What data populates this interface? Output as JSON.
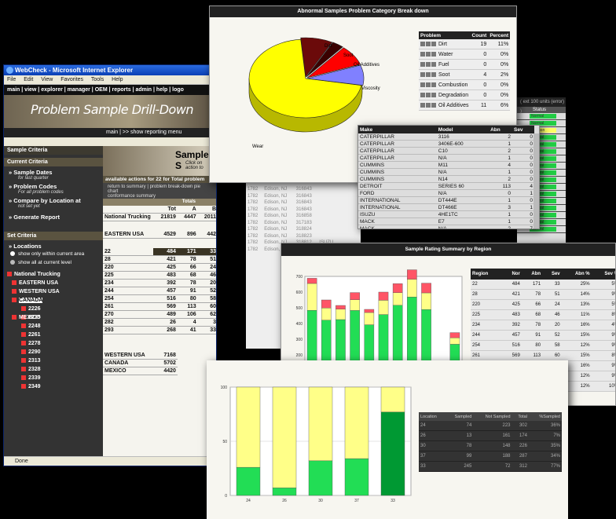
{
  "ie": {
    "title": "WebCheck - Microsoft Internet Explorer",
    "menu": [
      "File",
      "Edit",
      "View",
      "Favorites",
      "Tools",
      "Help"
    ],
    "nav": "main | view | explorer | manager | OEM | reports | admin | help | logo",
    "banner_title": "Problem Sample Drill-Down",
    "crumbs": "main | >> show reporting menu",
    "sidebar": {
      "sample_criteria": "Sample Criteria",
      "current_criteria": "Current Criteria",
      "sample_dates": "Sample Dates",
      "sample_dates_sub": "for last quarter",
      "problem_codes": "Problem Codes",
      "problem_codes_sub": "For all problem codes",
      "compare_by": "Compare by Location at",
      "compare_sub": "not set yet",
      "generate": "Generate Report",
      "set_criteria": "Set Criteria",
      "locations": "Locations",
      "radio_current": "show only within current area",
      "radio_all": "show all at current level"
    },
    "tree": {
      "root": "National Trucking",
      "nodes": [
        "EASTERN USA",
        "WESTERN USA",
        "CANADA"
      ],
      "leaves": [
        "2226",
        "2235",
        "2248",
        "2261",
        "2278",
        "2290",
        "2313",
        "2328",
        "2339",
        "2349"
      ],
      "last": "MEXICO"
    },
    "main": {
      "banner_title": "Sample S",
      "banner_desc1": "Click on",
      "banner_desc2": "action to",
      "actions": "available actions for 22 for Total problem",
      "links1": "return to summary | problem break-down pie chart",
      "links2": "conformance summary",
      "totals_label": "Totals",
      "col_headers": [
        "Tot",
        "A",
        "B"
      ],
      "rows": [
        {
          "name": "National Trucking",
          "v": [
            "21819",
            "4447",
            "2011"
          ]
        },
        {
          "name": "EASTERN USA",
          "v": [
            "4529",
            "896",
            "442"
          ]
        }
      ],
      "sub_rows": [
        {
          "name": "22",
          "v": [
            "484",
            "171",
            "33"
          ]
        },
        {
          "name": "28",
          "v": [
            "421",
            "78",
            "51"
          ]
        },
        {
          "name": "220",
          "v": [
            "425",
            "66",
            "24"
          ]
        },
        {
          "name": "225",
          "v": [
            "483",
            "68",
            "46"
          ]
        },
        {
          "name": "234",
          "v": [
            "392",
            "78",
            "20"
          ]
        },
        {
          "name": "244",
          "v": [
            "457",
            "91",
            "52"
          ]
        },
        {
          "name": "254",
          "v": [
            "516",
            "80",
            "58"
          ]
        },
        {
          "name": "261",
          "v": [
            "569",
            "113",
            "60"
          ]
        },
        {
          "name": "270",
          "v": [
            "489",
            "106",
            "62"
          ]
        },
        {
          "name": "282",
          "v": [
            "26",
            "4",
            "3"
          ]
        },
        {
          "name": "293",
          "v": [
            "268",
            "41",
            "33"
          ]
        }
      ],
      "bottom_rows": [
        {
          "name": "WESTERN USA",
          "v": "7168"
        },
        {
          "name": "CANADA",
          "v": "5702"
        },
        {
          "name": "MEXICO",
          "v": "4420"
        }
      ]
    },
    "status": "Done"
  },
  "detail": {
    "rows": [
      [
        "1782",
        "Edison, NJ",
        "316843",
        ""
      ],
      [
        "1782",
        "Edison, NJ",
        "316843",
        ""
      ],
      [
        "1782",
        "Edison, NJ",
        "316843",
        ""
      ],
      [
        "1782",
        "Edison, NJ",
        "316843",
        ""
      ],
      [
        "1782",
        "Edison, NJ",
        "316858",
        ""
      ],
      [
        "1782",
        "Edison, NJ",
        "317183",
        ""
      ],
      [
        "1782",
        "Edison, NJ",
        "318824",
        ""
      ],
      [
        "1782",
        "Edison, NJ",
        "318823",
        ""
      ],
      [
        "1782",
        "Edison, NJ",
        "318812",
        "ISUZU"
      ],
      [
        "1782",
        "Edison, NJ",
        "322287",
        "CATERPILLAR"
      ]
    ]
  },
  "cutwin": {
    "header": "( ext 100 units (error) )",
    "label": "Status",
    "statuses": [
      "Normal",
      "Normal",
      "Caution",
      "Normal",
      "Normal",
      "Normal",
      "Normal",
      "Normal",
      "Normal",
      "Normal",
      "Normal",
      "Normal",
      "Normal",
      "Normal",
      "Normal",
      "Normal",
      "Normal"
    ]
  },
  "pie": {
    "title": "Abnormal Samples Problem Category Break down",
    "headers": [
      "Problem",
      "Count",
      "Percent"
    ],
    "rows": [
      {
        "name": "Dirt",
        "count": "19",
        "pct": "11%"
      },
      {
        "name": "Water",
        "count": "0",
        "pct": "0%"
      },
      {
        "name": "Fuel",
        "count": "0",
        "pct": "0%"
      },
      {
        "name": "Soot",
        "count": "4",
        "pct": "2%"
      },
      {
        "name": "Combustion",
        "count": "0",
        "pct": "0%"
      },
      {
        "name": "Degradation",
        "count": "0",
        "pct": "0%"
      },
      {
        "name": "Oil Additives",
        "count": "11",
        "pct": "6%"
      }
    ],
    "labels": {
      "dirt": "Dirt",
      "soot": "Soot",
      "oil": "Oil Additives",
      "visc": "Viscosity",
      "wear": "Wear"
    },
    "colors": {
      "dirt": "#6b0a0a",
      "soot": "#3a0000",
      "oil": "#ff0000",
      "visc": "#8080ff",
      "wear": "#ffff00",
      "wear_side": "#b8b800"
    }
  },
  "models": {
    "headers": [
      "Make",
      "Model",
      "Abn",
      "Sev"
    ],
    "rows": [
      [
        "CATERPILLAR",
        "3116",
        "2",
        "0"
      ],
      [
        "CATERPILLAR",
        "3406E-600",
        "1",
        "0"
      ],
      [
        "CATERPILLAR",
        "C10",
        "2",
        "0"
      ],
      [
        "CATERPILLAR",
        "N/A",
        "1",
        "0"
      ],
      [
        "CUMMINS",
        "M11",
        "4",
        "0"
      ],
      [
        "CUMMINS",
        "N/A",
        "1",
        "0"
      ],
      [
        "CUMMINS",
        "N14",
        "2",
        "0"
      ],
      [
        "DETROIT",
        "SERIES 60",
        "113",
        "4"
      ],
      [
        "FORD",
        "N/A",
        "0",
        "1"
      ],
      [
        "INTERNATIONAL",
        "DT444E",
        "1",
        "0"
      ],
      [
        "INTERNATIONAL",
        "DT466E",
        "3",
        "1"
      ],
      [
        "ISUZU",
        "4HE1TC",
        "1",
        "0"
      ],
      [
        "MACK",
        "E7",
        "1",
        "0"
      ],
      [
        "MACK",
        "N/A",
        "2",
        "7"
      ]
    ]
  },
  "region": {
    "title": "Sample Rating Summary by Region",
    "headers": [
      "Region",
      "Nor",
      "Abn",
      "Sev",
      "Abn %",
      "Sev %"
    ],
    "rows": [
      [
        "22",
        "484",
        "171",
        "33",
        "25%",
        "5%"
      ],
      [
        "28",
        "421",
        "78",
        "51",
        "14%",
        "9%"
      ],
      [
        "220",
        "425",
        "66",
        "24",
        "13%",
        "5%"
      ],
      [
        "225",
        "483",
        "68",
        "46",
        "11%",
        "8%"
      ],
      [
        "234",
        "392",
        "78",
        "20",
        "16%",
        "4%"
      ],
      [
        "244",
        "457",
        "91",
        "52",
        "15%",
        "9%"
      ],
      [
        "254",
        "516",
        "80",
        "58",
        "12%",
        "9%"
      ],
      [
        "261",
        "569",
        "113",
        "60",
        "15%",
        "8%"
      ],
      [
        "270",
        "489",
        "106",
        "62",
        "16%",
        "9%"
      ],
      [
        "282",
        "26",
        "4",
        "3",
        "12%",
        "9%"
      ],
      [
        "293",
        "268",
        "41",
        "33",
        "12%",
        "10%"
      ]
    ],
    "chart_data": {
      "type": "bar",
      "categories": [
        "22",
        "28",
        "220",
        "225",
        "234",
        "244",
        "254",
        "261",
        "270",
        "282",
        "293"
      ],
      "series": [
        {
          "name": "Nor",
          "values": [
            484,
            421,
            425,
            483,
            392,
            457,
            516,
            569,
            489,
            26,
            268
          ]
        },
        {
          "name": "Abn",
          "values": [
            171,
            78,
            66,
            68,
            78,
            91,
            80,
            113,
            106,
            4,
            41
          ]
        },
        {
          "name": "Sev",
          "values": [
            33,
            51,
            24,
            46,
            20,
            52,
            58,
            60,
            62,
            3,
            33
          ]
        }
      ],
      "yticks": [
        "700",
        "600",
        "500",
        "400",
        "300",
        "200",
        "100",
        "0"
      ],
      "ylim": [
        0,
        700
      ],
      "stacked": true,
      "grid": false,
      "colors": [
        "#22dd55",
        "#ffff88",
        "#ff5566"
      ]
    }
  },
  "bottom": {
    "chart_data": {
      "type": "bar",
      "categories": [
        "24",
        "26",
        "30",
        "37",
        "33"
      ],
      "series": [
        {
          "values": [
            0.26,
            0.07,
            0.32,
            0.34,
            0.77
          ]
        },
        {
          "values": [
            0.74,
            0.93,
            0.68,
            0.66,
            0.23
          ]
        }
      ],
      "yticks": [
        "100",
        "50",
        "0"
      ],
      "ylim": [
        0,
        100
      ],
      "stacked": true,
      "colors": [
        "#22dd55",
        "#ffff88",
        "#009933"
      ]
    },
    "headers": [
      "Location",
      "Sampled",
      "Not Sampled",
      "Total",
      "%Sampled"
    ],
    "rows": [
      [
        "24",
        "74",
        "223",
        "302",
        "36%"
      ],
      [
        "26",
        "13",
        "161",
        "174",
        "7%"
      ],
      [
        "30",
        "78",
        "148",
        "226",
        "35%"
      ],
      [
        "37",
        "99",
        "188",
        "287",
        "34%"
      ],
      [
        "33",
        "245",
        "72",
        "312",
        "77%"
      ]
    ]
  }
}
